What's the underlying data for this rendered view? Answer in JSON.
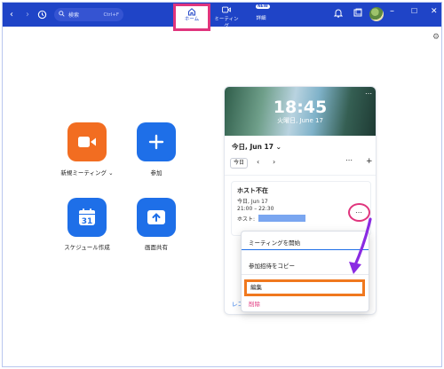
{
  "titlebar": {
    "search_placeholder": "検索",
    "search_shortcut": "Ctrl+F",
    "nav": [
      {
        "label": "ホーム",
        "active": true
      },
      {
        "label": "ミーティング",
        "active": false
      },
      {
        "label": "詳細",
        "active": false,
        "badge": "NEW"
      }
    ]
  },
  "actions": [
    {
      "label": "新規ミーティング",
      "icon": "video-camera-icon",
      "color": "#f26d21"
    },
    {
      "label": "参加",
      "icon": "plus-icon",
      "color": "#1e6fe8"
    },
    {
      "label": "スケジュール作成",
      "icon": "calendar-31-icon",
      "color": "#1e6fe8"
    },
    {
      "label": "画面共有",
      "icon": "share-screen-icon",
      "color": "#1e6fe8"
    }
  ],
  "calendar_icon_day": "31",
  "card": {
    "clock": "18:45",
    "date": "火曜日, June 17",
    "today_label": "今日, Jun 17",
    "today_button": "今日",
    "meeting": {
      "title": "ホスト不在",
      "line1": "今日, Jun 17",
      "line2": "21:00 – 22:30",
      "line3": "ホスト:"
    },
    "bottom_link": "レコ"
  },
  "menu": {
    "start": "ミーティングを開始",
    "copy": "参加招待をコピー",
    "edit": "編集",
    "delete": "削除"
  },
  "colors": {
    "titlebar": "#1f44c7",
    "highlight": "#e0357d",
    "edit_highlight": "#f0781e",
    "accent": "#1e6fe8"
  }
}
